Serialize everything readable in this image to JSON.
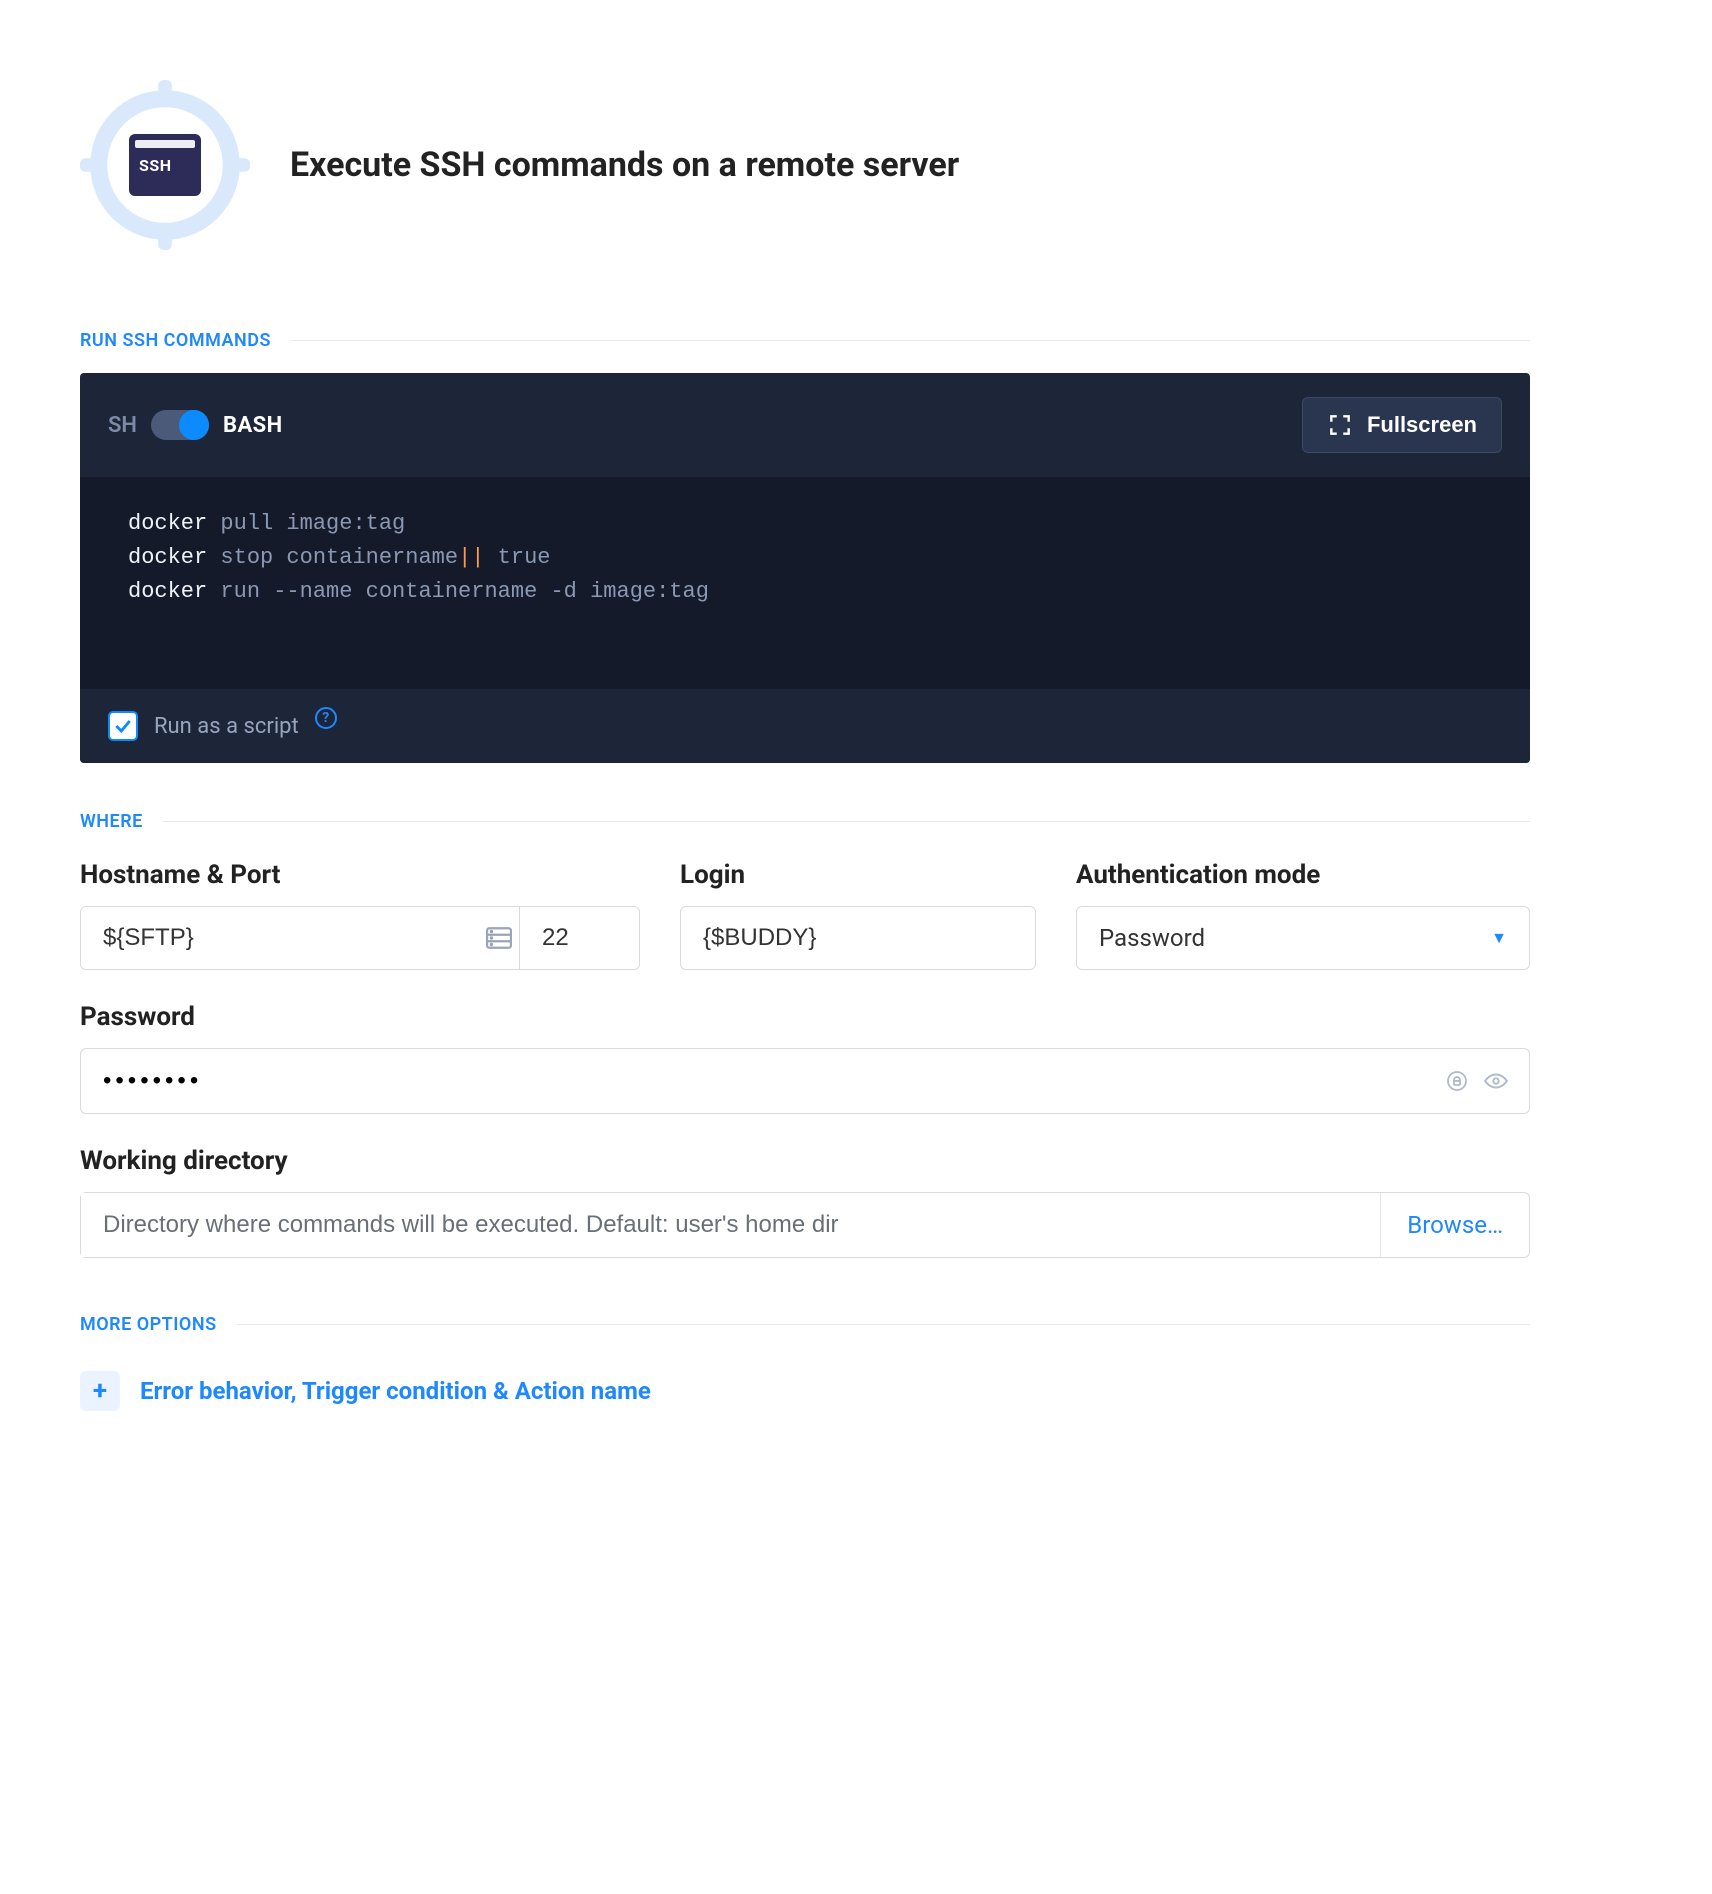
{
  "header": {
    "tile_label": "SSH",
    "title": "Execute SSH commands on a remote server"
  },
  "sections": {
    "run": "RUN SSH COMMANDS",
    "where": "WHERE",
    "more": "MORE OPTIONS"
  },
  "console": {
    "mode_left": "SH",
    "mode_right": "BASH",
    "fullscreen_label": "Fullscreen",
    "lines": [
      {
        "cmd": "docker",
        "rest": "pull image:tag"
      },
      {
        "cmd": "docker",
        "rest_parts": [
          "stop containername",
          "||",
          " true"
        ]
      },
      {
        "cmd": "docker",
        "rest": "run --name containername -d image:tag"
      }
    ],
    "run_as_script_label": "Run as a script",
    "run_as_script_checked": true
  },
  "where": {
    "hostname_label": "Hostname & Port",
    "hostname_value": "${SFTP}",
    "port_value": "22",
    "login_label": "Login",
    "login_value": "{$BUDDY}",
    "auth_mode_label": "Authentication mode",
    "auth_mode_value": "Password",
    "password_label": "Password",
    "password_value": "••••••••",
    "wd_label": "Working directory",
    "wd_placeholder": "Directory where commands will be executed. Default: user's home dir",
    "browse_label": "Browse…"
  },
  "more": {
    "expand_label": "Error behavior, Trigger condition & Action name"
  }
}
